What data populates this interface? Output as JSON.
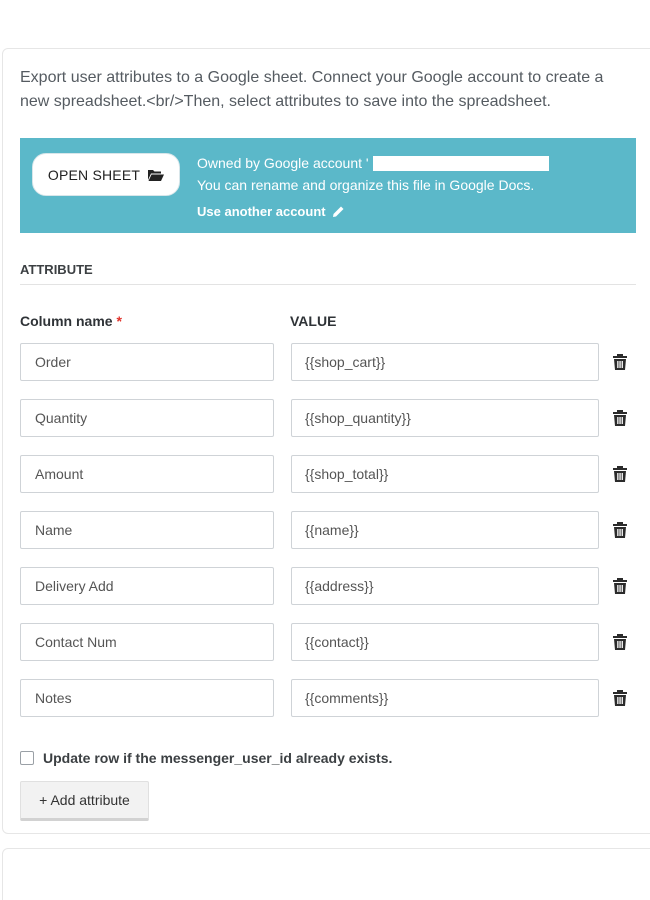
{
  "description": "Export user attributes to a Google sheet. Connect your Google account to create a new spreadsheet.<br/>Then, select attributes to save into the spreadsheet.",
  "banner": {
    "open_sheet_label": "OPEN SHEET",
    "owned_by": "Owned by Google account '",
    "rename_note": "You can rename and organize this file in Google Docs.",
    "use_another": "Use another account",
    "background_color": "#5bb8c9"
  },
  "attribute_heading": "ATTRIBUTE",
  "columns": {
    "name_header": "Column name",
    "required_mark": "*",
    "value_header": "VALUE"
  },
  "rows": [
    {
      "name": "Order",
      "value": "{{shop_cart}}"
    },
    {
      "name": "Quantity",
      "value": "{{shop_quantity}}"
    },
    {
      "name": "Amount",
      "value": "{{shop_total}}"
    },
    {
      "name": "Name",
      "value": "{{name}}"
    },
    {
      "name": "Delivery Add",
      "value": "{{address}}"
    },
    {
      "name": "Contact Num",
      "value": "{{contact}}"
    },
    {
      "name": "Notes",
      "value": "{{comments}}"
    }
  ],
  "update_row_label": "Update row if the messenger_user_id already exists.",
  "update_row_checked": false,
  "add_attribute_label": "+ Add attribute",
  "icons": {
    "open_sheet": "folder-open-icon",
    "use_another": "pencil-icon",
    "row_delete": "trash-icon"
  }
}
